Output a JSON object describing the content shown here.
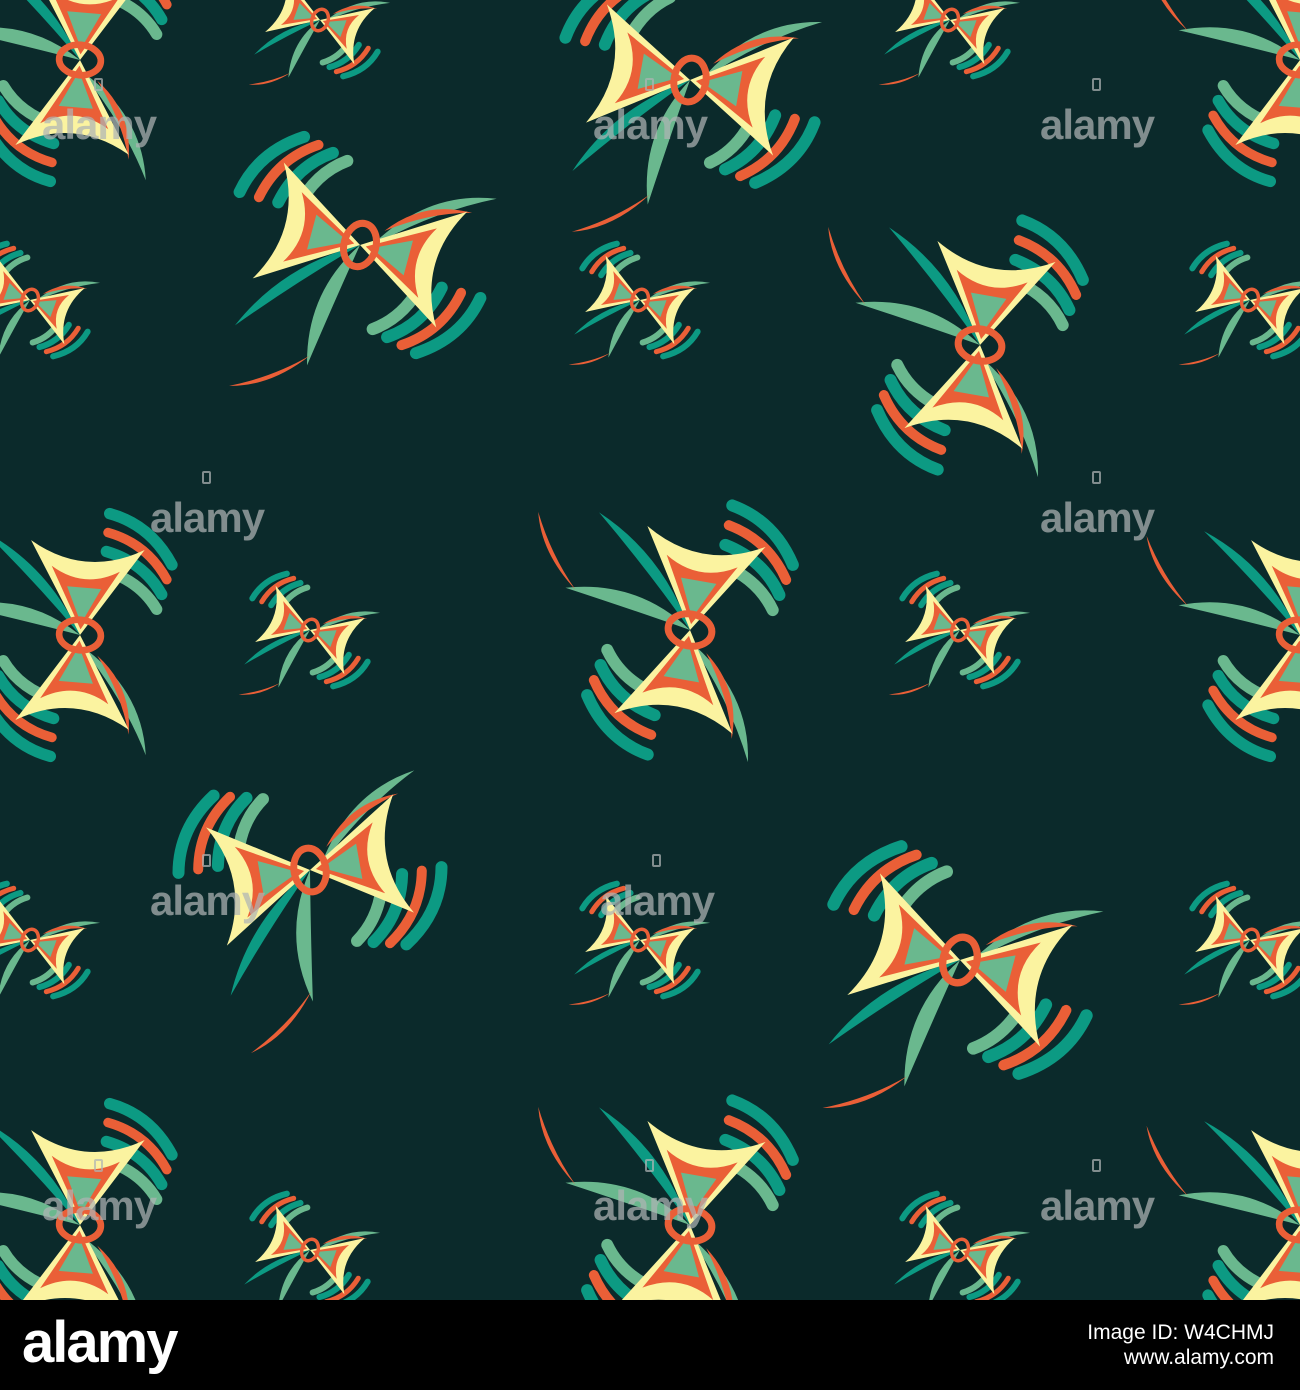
{
  "colors": {
    "background": "#0b2a2b",
    "cream": "#fbf3a0",
    "orange": "#ea5f37",
    "teal": "#0c9a83",
    "sage": "#6ab88e",
    "watermark": "#b0b4b4",
    "footer_bg": "#000000",
    "footer_text": "#ffffff"
  },
  "watermark": {
    "text": "alamy"
  },
  "footer": {
    "logo": "alamy",
    "image_id_label": "Image ID: W4CHMJ",
    "site": "www.alamy.com"
  },
  "motif": {
    "name": "bow-ribbon-motif",
    "icon": "butterfly-bow-icon"
  }
}
